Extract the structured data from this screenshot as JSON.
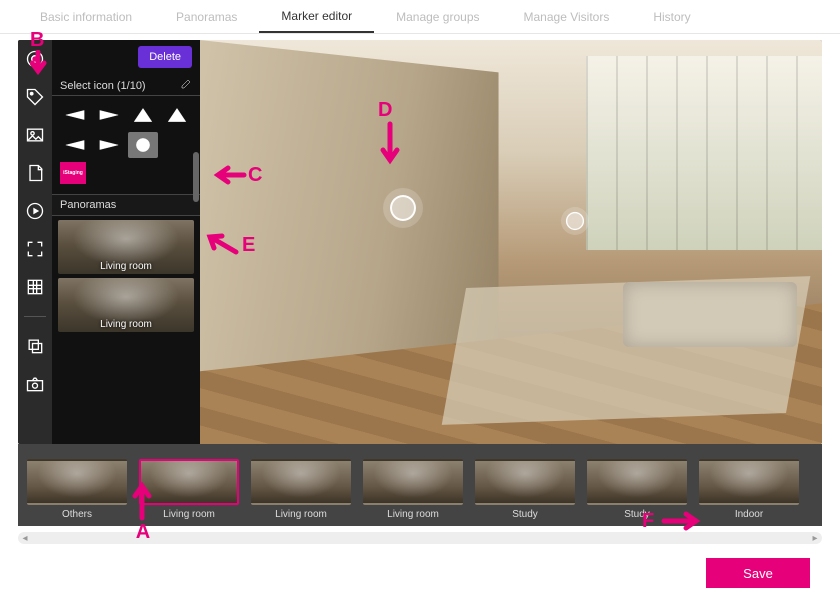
{
  "tabs": [
    {
      "label": "Basic information",
      "active": false
    },
    {
      "label": "Panoramas",
      "active": false
    },
    {
      "label": "Marker editor",
      "active": true
    },
    {
      "label": "Manage groups",
      "active": false
    },
    {
      "label": "Manage Visitors",
      "active": false
    },
    {
      "label": "History",
      "active": false
    }
  ],
  "panel": {
    "delete_label": "Delete",
    "select_icon_label": "Select icon (1/10)",
    "panoramas_label": "Panoramas",
    "pano_items": [
      "Living room",
      "Living room"
    ],
    "istaging_label": "iStaging"
  },
  "filmstrip": [
    "Others",
    "Living room",
    "Living room",
    "Living room",
    "Study",
    "Study",
    "Indoor"
  ],
  "filmstrip_selected_index": 1,
  "save_label": "Save",
  "annotations": {
    "A": "A",
    "B": "B",
    "C": "C",
    "D": "D",
    "E": "E",
    "F": "F"
  },
  "colors": {
    "accent": "#e6007a",
    "delete_btn": "#6a30d8"
  }
}
